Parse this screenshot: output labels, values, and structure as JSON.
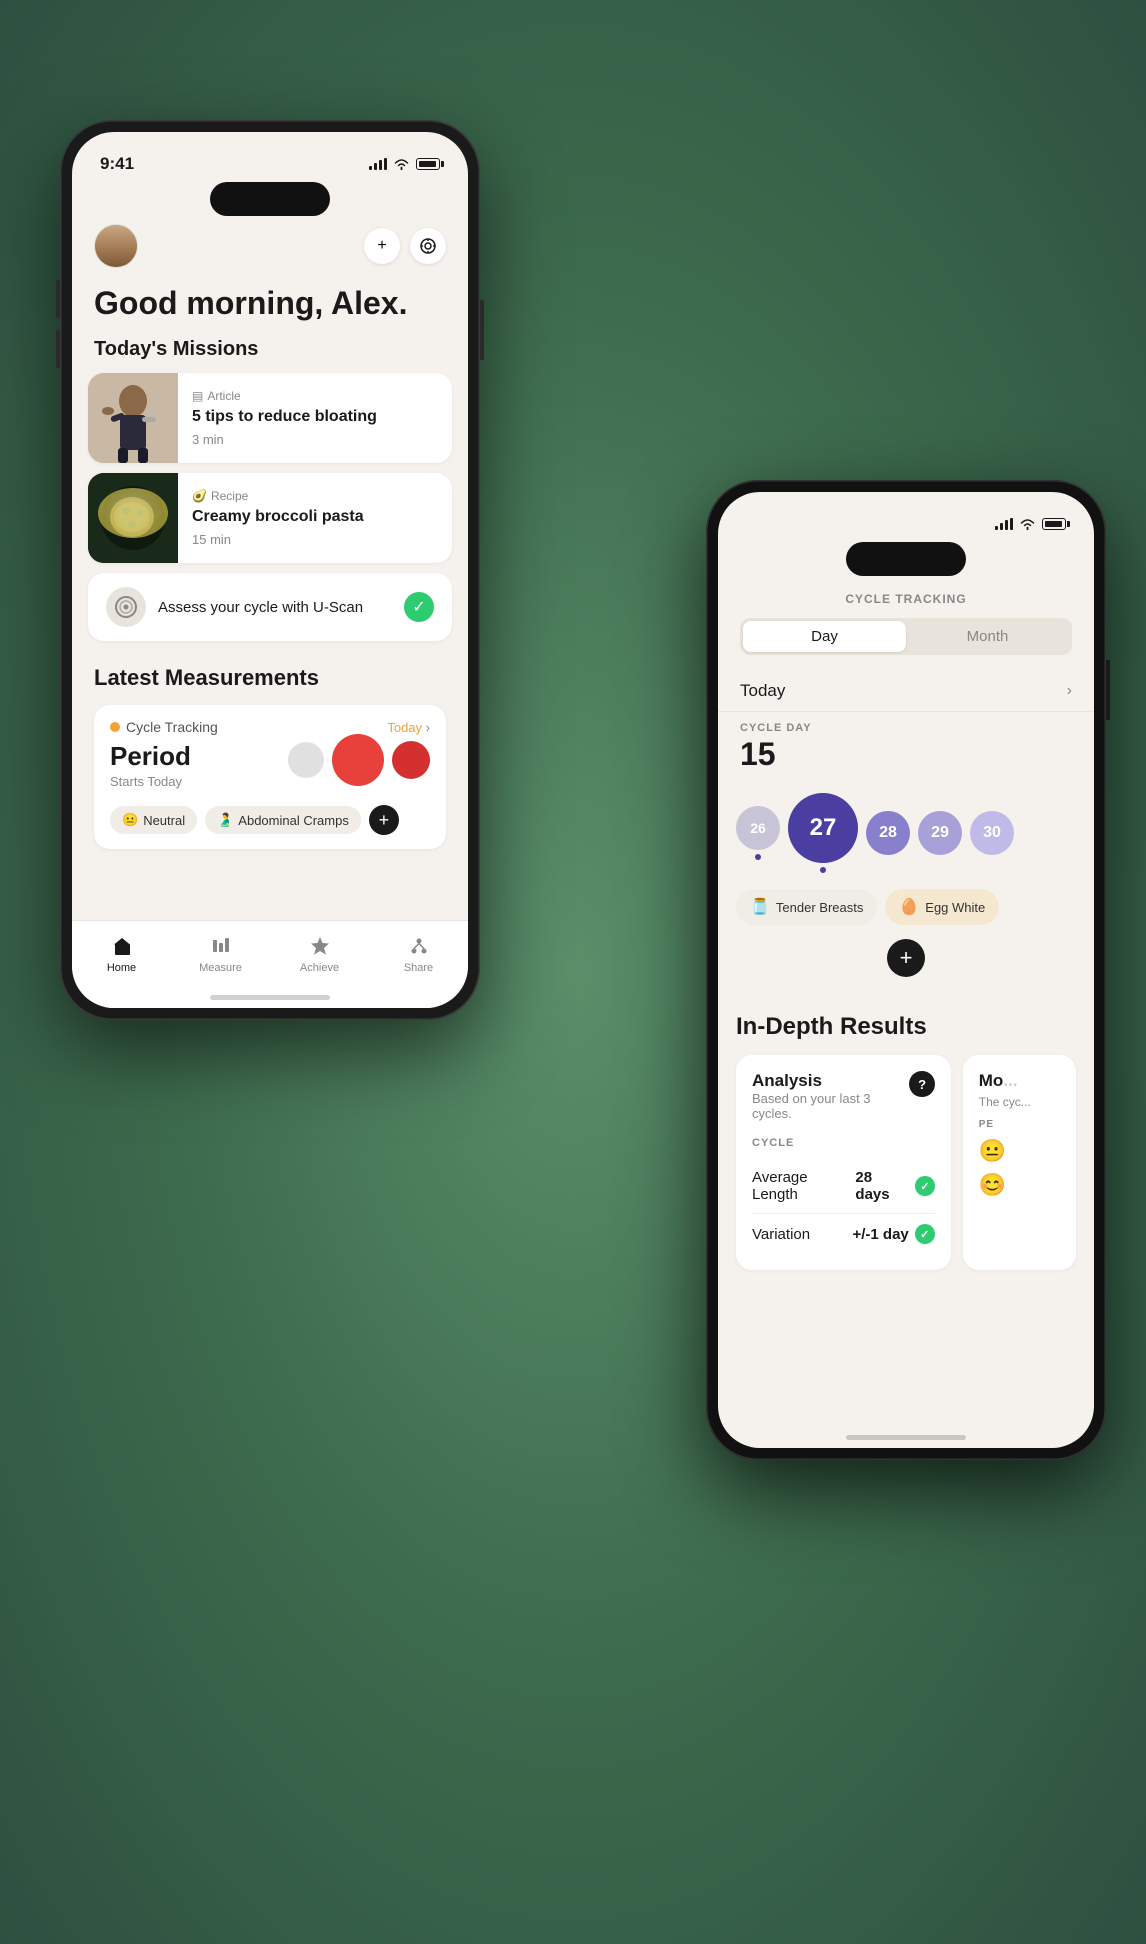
{
  "phone1": {
    "status": {
      "time": "9:41",
      "signal": true,
      "wifi": true,
      "battery": true
    },
    "header": {
      "greeting": "Good morning, Alex.",
      "add_button": "+",
      "scan_icon": "⊙"
    },
    "missions": {
      "title": "Today's Missions",
      "items": [
        {
          "type": "Article",
          "title": "5 tips to reduce bloating",
          "duration": "3 min",
          "image_type": "woman-drinking"
        },
        {
          "type": "Recipe",
          "title": "Creamy broccoli pasta",
          "duration": "15 min",
          "image_type": "pasta"
        }
      ]
    },
    "uscan": {
      "text": "Assess your cycle with U-Scan",
      "status": "complete"
    },
    "measurements": {
      "title": "Latest Measurements",
      "card": {
        "label": "Cycle Tracking",
        "today_label": "Today",
        "value": "Period",
        "sub": "Starts Today",
        "tags": [
          "Neutral",
          "Abdominal Cramps"
        ]
      }
    },
    "nav": {
      "items": [
        {
          "label": "Home",
          "icon": "home",
          "active": true
        },
        {
          "label": "Measure",
          "icon": "measure",
          "active": false
        },
        {
          "label": "Achieve",
          "icon": "achieve",
          "active": false
        },
        {
          "label": "Share",
          "icon": "share",
          "active": false
        }
      ]
    }
  },
  "phone2": {
    "status": {
      "signal": true,
      "wifi": true,
      "battery": true
    },
    "page_title": "CYCLE TRACKING",
    "toggle": {
      "day": "Day",
      "month": "Month",
      "active": "day"
    },
    "today_row": {
      "label": "Today",
      "has_chevron": true
    },
    "cycle_day": {
      "label": "CYCLE DAY",
      "number": "15"
    },
    "dots": [
      {
        "num": "26",
        "size": "sm",
        "color": "gray-dot",
        "has_dot": true
      },
      {
        "num": "27",
        "size": "lg",
        "color": "purple-dark",
        "has_dot": true
      },
      {
        "num": "28",
        "size": "sm",
        "color": "purple-med"
      },
      {
        "num": "29",
        "size": "sm",
        "color": "purple-light"
      },
      {
        "num": "30",
        "size": "sm",
        "color": "purple-pale"
      }
    ],
    "symptoms": [
      {
        "icon": "🫙",
        "label": "Tender Breasts",
        "style": "default"
      },
      {
        "icon": "🥚",
        "label": "Egg White",
        "style": "orange"
      }
    ],
    "in_depth": {
      "title": "In-Depth Results",
      "analysis": {
        "title": "Analysis",
        "subtitle": "Based on your last 3 cycles.",
        "cycle_label": "CYCLE",
        "rows": [
          {
            "label": "Average Length",
            "value": "28 days",
            "status": "good"
          },
          {
            "label": "Variation",
            "value": "+/-1 day",
            "status": "good"
          }
        ]
      },
      "partial_card": {
        "title": "Mo",
        "content": "The cyc",
        "label": "PE"
      }
    }
  }
}
